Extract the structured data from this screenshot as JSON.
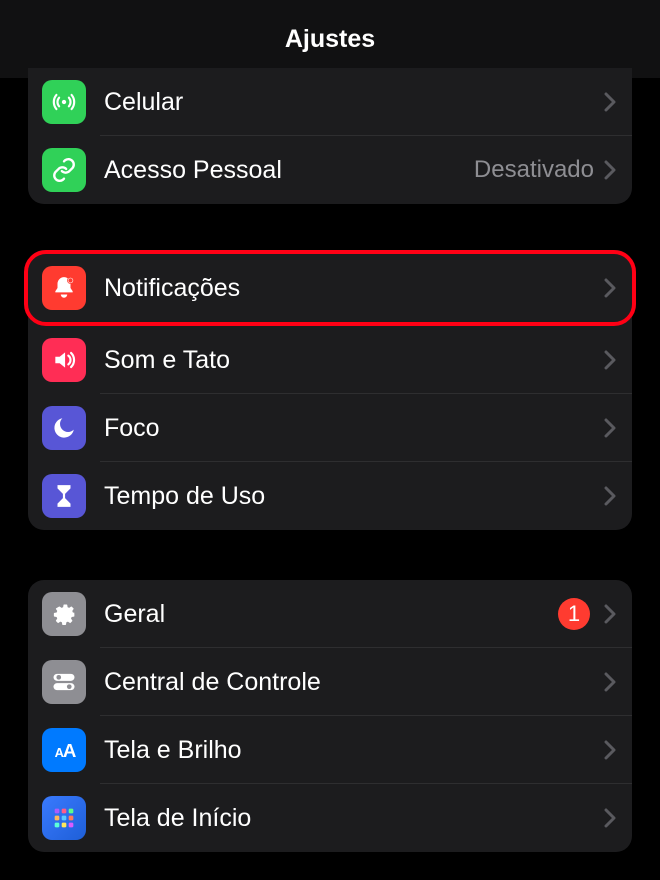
{
  "header": {
    "title": "Ajustes"
  },
  "group1": {
    "items": [
      {
        "label": "Celular"
      },
      {
        "label": "Acesso Pessoal",
        "value": "Desativado"
      }
    ]
  },
  "group2": {
    "items": [
      {
        "label": "Notificações"
      },
      {
        "label": "Som e Tato"
      },
      {
        "label": "Foco"
      },
      {
        "label": "Tempo de Uso"
      }
    ]
  },
  "group3": {
    "items": [
      {
        "label": "Geral",
        "badge": "1"
      },
      {
        "label": "Central de Controle"
      },
      {
        "label": "Tela e Brilho"
      },
      {
        "label": "Tela de Início"
      }
    ]
  }
}
